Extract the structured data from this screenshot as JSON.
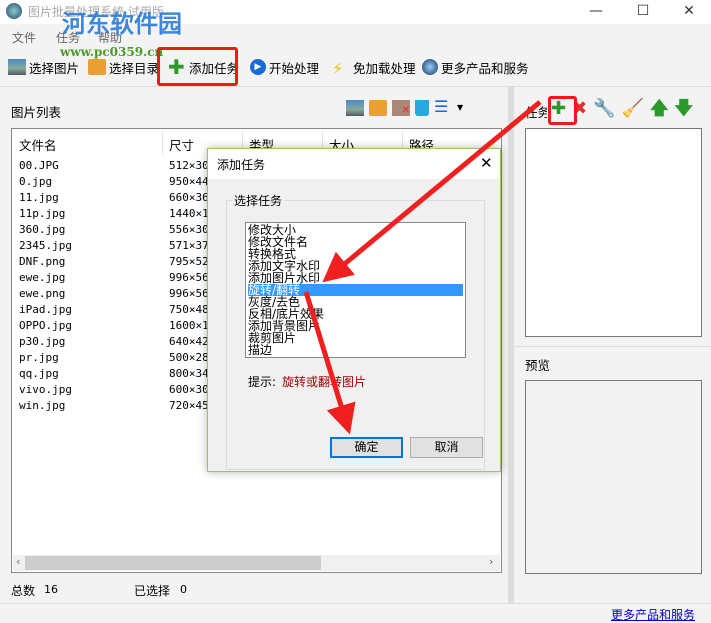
{
  "window": {
    "title": "图片批量处理系统 试用版",
    "min": "—",
    "max": "☐",
    "close": "✕"
  },
  "watermark": {
    "name": "河东软件园",
    "url": "www.pc0359.cn"
  },
  "menu": [
    "文件",
    "任务",
    "帮助"
  ],
  "toolbar": [
    "选择图片",
    "选择目录",
    "添加任务",
    "开始处理",
    "免加载处理",
    "更多产品和服务"
  ],
  "left": {
    "title": "图片列表",
    "columns": [
      "文件名",
      "尺寸",
      "类型",
      "大小",
      "路径"
    ],
    "files": [
      {
        "name": "00.JPG",
        "size": "512×30"
      },
      {
        "name": "0.jpg",
        "size": "950×44"
      },
      {
        "name": "11.jpg",
        "size": "660×36"
      },
      {
        "name": "11p.jpg",
        "size": "1440×1"
      },
      {
        "name": "360.jpg",
        "size": "556×30"
      },
      {
        "name": "2345.jpg",
        "size": "571×37"
      },
      {
        "name": "DNF.png",
        "size": "795×52"
      },
      {
        "name": "ewe.jpg",
        "size": "996×56"
      },
      {
        "name": "ewe.png",
        "size": "996×56"
      },
      {
        "name": "iPad.jpg",
        "size": "750×48"
      },
      {
        "name": "OPPO.jpg",
        "size": "1600×1"
      },
      {
        "name": "p30.jpg",
        "size": "640×42"
      },
      {
        "name": "pr.jpg",
        "size": "500×28"
      },
      {
        "name": "qq.jpg",
        "size": "800×34"
      },
      {
        "name": "vivo.jpg",
        "size": "600×30"
      },
      {
        "name": "win.jpg",
        "size": "720×45"
      }
    ],
    "total_label": "总数",
    "total": "16",
    "selected_label": "已选择",
    "selected": "0"
  },
  "right": {
    "task_label": "任务",
    "preview_label": "预览"
  },
  "footer": {
    "link": "更多产品和服务"
  },
  "dialog": {
    "title": "添加任务",
    "group": "选择任务",
    "items": [
      "修改大小",
      "修改文件名",
      "转换格式",
      "添加文字水印",
      "添加图片水印",
      "旋转/翻转",
      "灰度/去色",
      "反相/底片效果",
      "添加背景图片",
      "裁剪图片",
      "描边"
    ],
    "selected_index": 5,
    "hint_label": "提示:",
    "hint": "旋转或翻转图片",
    "ok": "确定",
    "cancel": "取消",
    "close": "✕"
  }
}
